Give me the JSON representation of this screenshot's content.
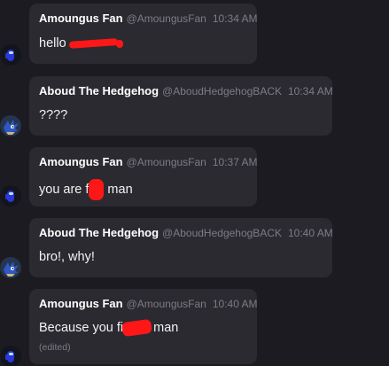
{
  "messages": [
    {
      "author": "Amoungus Fan",
      "handle": "@AmoungusFan",
      "time": "10:34 AM",
      "text_before": "hello",
      "text_after": "",
      "redacted": true,
      "edited": "",
      "avatar": "amongus-crewmate-avatar"
    },
    {
      "author": "Aboud The Hedgehog",
      "handle": "@AboudHedgehogBACK",
      "time": "10:34 AM",
      "text_before": "????",
      "text_after": "",
      "redacted": false,
      "edited": "",
      "avatar": "hedgehog-avatar"
    },
    {
      "author": "Amoungus Fan",
      "handle": "@AmoungusFan",
      "time": "10:37 AM",
      "text_before": "you are f",
      "text_after": "man",
      "redacted": true,
      "edited": "",
      "avatar": "amongus-crewmate-avatar"
    },
    {
      "author": "Aboud The Hedgehog",
      "handle": "@AboudHedgehogBACK",
      "time": "10:40 AM",
      "text_before": "bro!, why!",
      "text_after": "",
      "redacted": false,
      "edited": "",
      "avatar": "hedgehog-avatar"
    },
    {
      "author": "Amoungus Fan",
      "handle": "@AmoungusFan",
      "time": "10:40 AM",
      "text_before": "Because you fi",
      "text_after": "man",
      "redacted": true,
      "edited": "(edited)",
      "avatar": "amongus-crewmate-avatar"
    }
  ],
  "colors": {
    "background": "#1c1b21",
    "bubble": "#2b2a31",
    "redaction": "#ff1717",
    "muted_text": "#7d7c84"
  }
}
